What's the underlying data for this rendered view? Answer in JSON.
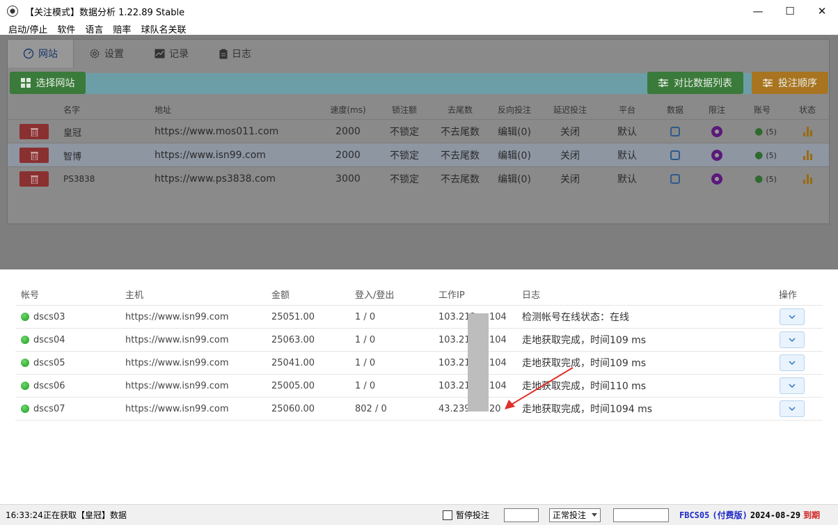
{
  "window": {
    "title": "【关注模式】数据分析 1.22.89 Stable",
    "minimize_glyph": "—",
    "maximize_glyph": "☐",
    "close_glyph": "✕"
  },
  "menu": [
    "启动/停止",
    "软件",
    "语言",
    "赔率",
    "球队名关联"
  ],
  "tabs": [
    {
      "label": "网站",
      "icon": "gauge-icon"
    },
    {
      "label": "设置",
      "icon": "gear-icon"
    },
    {
      "label": "记录",
      "icon": "chart-icon"
    },
    {
      "label": "日志",
      "icon": "clipboard-icon"
    }
  ],
  "toolbar": {
    "select_site": "选择网站",
    "compare_list": "对比数据列表",
    "bet_order": "投注顺序"
  },
  "sites_grid": {
    "columns": [
      "名字",
      "地址",
      "速度(ms)",
      "锁注额",
      "去尾数",
      "反向投注",
      "延迟投注",
      "平台",
      "数据",
      "限注",
      "账号",
      "状态"
    ],
    "rows": [
      {
        "name": "皇冠",
        "url": "https://www.mos011.com",
        "speed": "2000",
        "lock": "不锁定",
        "tail": "不去尾数",
        "reverse": "编辑(0)",
        "delay": "关闭",
        "platform": "默认",
        "accounts": "(5)",
        "selected": false
      },
      {
        "name": "智博",
        "url": "https://www.isn99.com",
        "speed": "2000",
        "lock": "不锁定",
        "tail": "不去尾数",
        "reverse": "编辑(0)",
        "delay": "关闭",
        "platform": "默认",
        "accounts": "(5)",
        "selected": true
      },
      {
        "name": "PS3838",
        "url": "https://www.ps3838.com",
        "speed": "3000",
        "lock": "不锁定",
        "tail": "不去尾数",
        "reverse": "编辑(0)",
        "delay": "关闭",
        "platform": "默认",
        "accounts": "(5)",
        "selected": false
      }
    ]
  },
  "accounts_table": {
    "columns": [
      "帐号",
      "主机",
      "金额",
      "登入/登出",
      "工作IP",
      "日志",
      "操作"
    ],
    "rows": [
      {
        "account": "dscs03",
        "host": "https://www.isn99.com",
        "amount": "25051.00",
        "login": "1 / 0",
        "ip_prefix": "103.212",
        "ip_suffix": "104",
        "log": "检测帐号在线状态：在线"
      },
      {
        "account": "dscs04",
        "host": "https://www.isn99.com",
        "amount": "25063.00",
        "login": "1 / 0",
        "ip_prefix": "103.212",
        "ip_suffix": "104",
        "log": "走地获取完成，时间109 ms"
      },
      {
        "account": "dscs05",
        "host": "https://www.isn99.com",
        "amount": "25041.00",
        "login": "1 / 0",
        "ip_prefix": "103.212",
        "ip_suffix": "104",
        "log": "走地获取完成，时间109 ms"
      },
      {
        "account": "dscs06",
        "host": "https://www.isn99.com",
        "amount": "25005.00",
        "login": "1 / 0",
        "ip_prefix": "103.212",
        "ip_suffix": "104",
        "log": "走地获取完成，时间110 ms"
      },
      {
        "account": "dscs07",
        "host": "https://www.isn99.com",
        "amount": "25060.00",
        "login": "802 / 0",
        "ip_prefix": "43.239.",
        "ip_suffix": "20",
        "log": "走地获取完成，时间1094 ms"
      }
    ]
  },
  "statusbar": {
    "time": "16:33:24",
    "message": "正在获取【皇冠】数据",
    "pause_label": "暂停投注",
    "mode_value": "正常投注",
    "license_code": "FBCS05",
    "license_type": "(付费版)",
    "license_date": "2024-08-29",
    "license_status": "到期"
  },
  "colors": {
    "annotation_arrow": "#e0302a",
    "online_dot": "#22a022"
  }
}
